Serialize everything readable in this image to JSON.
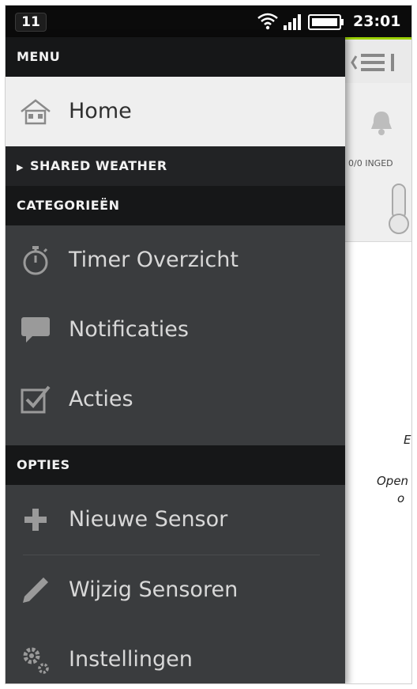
{
  "status_bar": {
    "notification_count": "11",
    "time": "23:01"
  },
  "drawer": {
    "header_menu": "MENU",
    "home_label": "Home",
    "shared_weather_label": "SHARED WEATHER",
    "header_categories": "CATEGORIEËN",
    "categories": [
      {
        "label": "Timer Overzicht",
        "icon": "stopwatch-icon"
      },
      {
        "label": "Notificaties",
        "icon": "speech-bubble-icon"
      },
      {
        "label": "Acties",
        "icon": "checkbox-icon"
      }
    ],
    "header_options": "OPTIES",
    "options": [
      {
        "label": "Nieuwe Sensor",
        "icon": "plus-icon"
      },
      {
        "label": "Wijzig Sensoren",
        "icon": "pencil-icon"
      },
      {
        "label": "Instellingen",
        "icon": "gears-icon"
      }
    ]
  },
  "background_app": {
    "sensor_status": "0/0 INGED",
    "text_line1": "Ei",
    "text_line2": "Open",
    "text_line3": "o"
  },
  "colors": {
    "drawer_bg": "#3a3c3e",
    "header_bg": "#161718",
    "home_bg": "#efefef",
    "accent": "#9bd000"
  }
}
